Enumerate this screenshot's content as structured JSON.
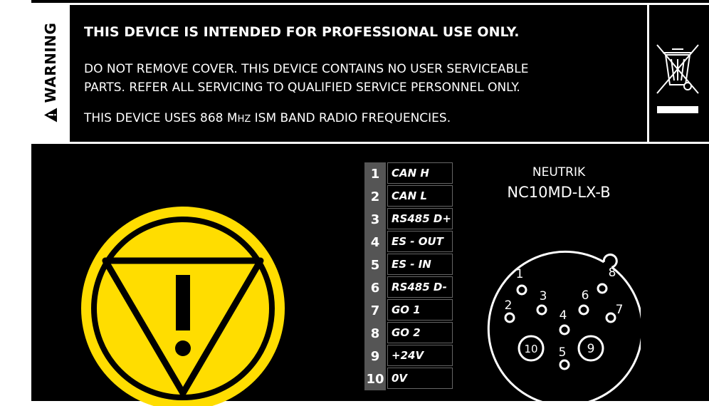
{
  "warning": {
    "label": "WARNING",
    "line1": "THIS DEVICE IS INTENDED FOR PROFESSIONAL USE ONLY.",
    "line2a": "DO NOT REMOVE COVER. THIS DEVICE CONTAINS NO USER SERVICEABLE",
    "line2b": "PARTS. REFER ALL SERVICING TO QUALIFIED SERVICE PERSONNEL ONLY.",
    "line3_pre": "THIS DEVICE USES 868 M",
    "line3_sc": "HZ",
    "line3_post": " ISM BAND RADIO FREQUENCIES."
  },
  "connector": {
    "brand": "NEUTRIK",
    "model": "NC10MD-LX-B",
    "pins": [
      {
        "num": "1",
        "label": "CAN H"
      },
      {
        "num": "2",
        "label": "CAN L"
      },
      {
        "num": "3",
        "label": "RS485 D+"
      },
      {
        "num": "4",
        "label": "ES - OUT"
      },
      {
        "num": "5",
        "label": "ES - IN"
      },
      {
        "num": "6",
        "label": "RS485 D-"
      },
      {
        "num": "7",
        "label": "GO 1"
      },
      {
        "num": "8",
        "label": "GO 2"
      },
      {
        "num": "9",
        "label": "+24V"
      },
      {
        "num": "10",
        "label": "0V"
      }
    ],
    "diagram_labels": [
      "1",
      "2",
      "3",
      "4",
      "5",
      "6",
      "7",
      "8",
      "9",
      "10"
    ]
  },
  "colors": {
    "background": "#000000",
    "warning_yellow": "#ffdd00",
    "text": "#ffffff",
    "pin_number_bg": "#555555"
  },
  "icons": [
    "warning-triangle-icon",
    "weee-crossed-bin-icon",
    "estop-symbol-icon"
  ]
}
